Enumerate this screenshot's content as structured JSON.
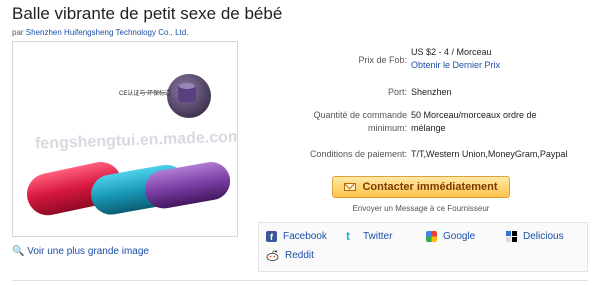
{
  "product": {
    "title": "Balle vibrante de petit sexe de bébé",
    "supplier_prefix": "par",
    "supplier_name": "Shenzhen Huifengsheng Technology Co., Ltd."
  },
  "image": {
    "watermark": "fengshengtui.en.made.com",
    "ce_note": "CE认证与 环保标志",
    "enlarge_link": "Voir une plus grande image",
    "colors": {
      "red": "#d6173f",
      "teal": "#1a9bb8",
      "purple": "#7c3fa6"
    }
  },
  "attributes": {
    "fob_label": "Prix de Fob:",
    "fob_value": "US $2 - 4 / Morceau",
    "fob_link": "Obtenir le Dernier Prix",
    "port_label": "Port:",
    "port_value": "Shenzhen",
    "moq_label": "Quantité de commande minimum:",
    "moq_value": "50 Morceau/morceaux ordre de mélange",
    "payment_label": "Conditions de paiement:",
    "payment_value": "T/T,Western Union,MoneyGram,Paypal"
  },
  "contact": {
    "button_label": "Contacter immédiatement",
    "sub_text": "Envoyer un Message à ce Fournisseur"
  },
  "share": {
    "facebook": "Facebook",
    "twitter": "Twitter",
    "google": "Google",
    "delicious": "Delicious",
    "reddit": "Reddit"
  },
  "theme": {
    "link": "#1a4ea8",
    "button": "#ffc34d"
  }
}
